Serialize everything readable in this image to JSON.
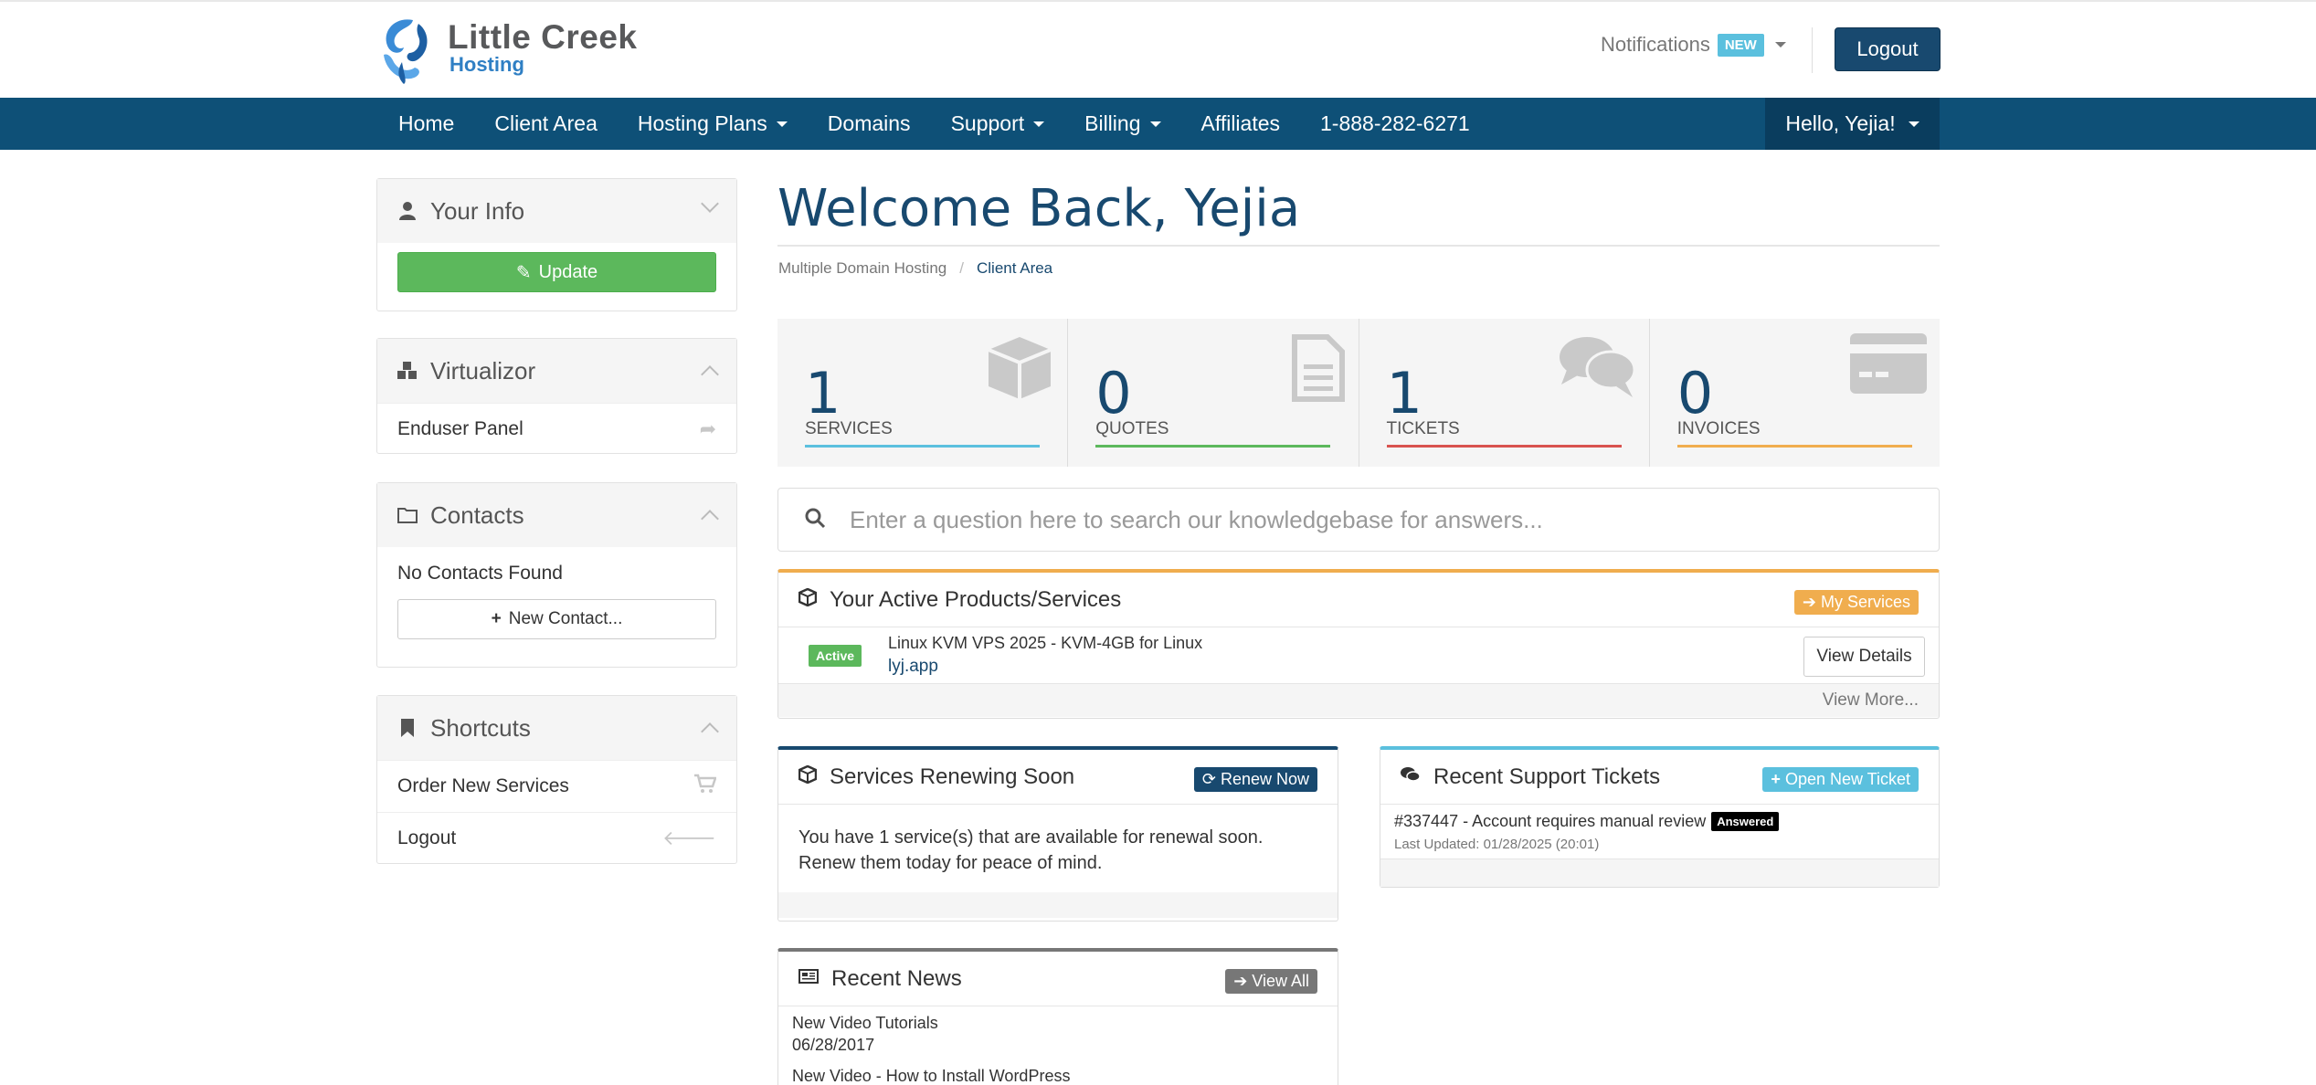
{
  "brand": {
    "name": "Little Creek",
    "sub": "Hosting"
  },
  "header": {
    "notifications_label": "Notifications",
    "notifications_badge": "NEW",
    "logout_label": "Logout"
  },
  "nav": {
    "items": [
      {
        "label": "Home",
        "dropdown": false
      },
      {
        "label": "Client Area",
        "dropdown": false
      },
      {
        "label": "Hosting Plans",
        "dropdown": true
      },
      {
        "label": "Domains",
        "dropdown": false
      },
      {
        "label": "Support",
        "dropdown": true
      },
      {
        "label": "Billing",
        "dropdown": true
      },
      {
        "label": "Affiliates",
        "dropdown": false
      },
      {
        "label": "1-888-282-6271",
        "dropdown": false
      }
    ],
    "user_label": "Hello, Yejia!"
  },
  "sidebar": {
    "your_info": {
      "title": "Your Info",
      "button": "Update"
    },
    "virtualizor": {
      "title": "Virtualizor",
      "items": [
        "Enduser Panel"
      ]
    },
    "contacts": {
      "title": "Contacts",
      "empty_text": "No Contacts Found",
      "button": "New Contact..."
    },
    "shortcuts": {
      "title": "Shortcuts",
      "items": [
        "Order New Services",
        "Logout"
      ]
    }
  },
  "main": {
    "title": "Welcome Back, Yejia",
    "breadcrumb": [
      "Multiple Domain Hosting",
      "Client Area"
    ],
    "stats": [
      {
        "value": "1",
        "label": "SERVICES",
        "color": "#5bc0de",
        "icon": "cube-icon"
      },
      {
        "value": "0",
        "label": "QUOTES",
        "color": "#5cb85c",
        "icon": "document-icon"
      },
      {
        "value": "1",
        "label": "TICKETS",
        "color": "#d9534f",
        "icon": "comments-icon"
      },
      {
        "value": "0",
        "label": "INVOICES",
        "color": "#f0ad4e",
        "icon": "credit-card-icon"
      }
    ],
    "search_placeholder": "Enter a question here to search our knowledgebase for answers...",
    "active_services": {
      "title": "Your Active Products/Services",
      "button": "My Services",
      "accent": "#f0ad4e",
      "rows": [
        {
          "status": "Active",
          "name": "Linux KVM VPS 2025 - KVM-4GB for Linux",
          "domain": "lyj.app",
          "button": "View Details"
        }
      ],
      "footer": "View More..."
    },
    "renewing": {
      "title": "Services Renewing Soon",
      "button": "Renew Now",
      "accent": "#18496f",
      "text": "You have 1 service(s) that are available for renewal soon. Renew them today for peace of mind."
    },
    "tickets": {
      "title": "Recent Support Tickets",
      "button": "Open New Ticket",
      "accent": "#5bc0de",
      "rows": [
        {
          "title": "#337447 - Account requires manual review",
          "status": "Answered",
          "meta": "Last Updated: 01/28/2025 (20:01)"
        }
      ]
    },
    "news": {
      "title": "Recent News",
      "button": "View All",
      "accent": "#777777",
      "items": [
        {
          "title": "New Video Tutorials",
          "date": "06/28/2017"
        },
        {
          "title": "New Video - How to Install WordPress",
          "date": ""
        }
      ]
    }
  }
}
